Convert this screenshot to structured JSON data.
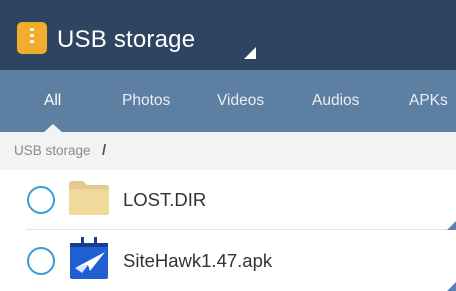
{
  "titlebar": {
    "title": "USB storage",
    "icon": "zip-archive-icon",
    "dropdown_icon": "dropdown-triangle-icon",
    "colors": {
      "background": "#2e4460",
      "icon_accent": "#f3ad2c"
    }
  },
  "tabs": [
    {
      "label": "All",
      "active": true
    },
    {
      "label": "Photos",
      "active": false
    },
    {
      "label": "Videos",
      "active": false
    },
    {
      "label": "Audios",
      "active": false
    },
    {
      "label": "APKs",
      "active": false
    }
  ],
  "tabs_color": "#5d7fa2",
  "breadcrumb": {
    "path": "USB storage",
    "separator": "/"
  },
  "files": [
    {
      "name": "LOST.DIR",
      "icon": "folder-icon",
      "selected": false
    },
    {
      "name": "SiteHawk1.47.apk",
      "icon": "apk-icon",
      "selected": false
    }
  ],
  "checkbox_color": "#3a9bd9"
}
